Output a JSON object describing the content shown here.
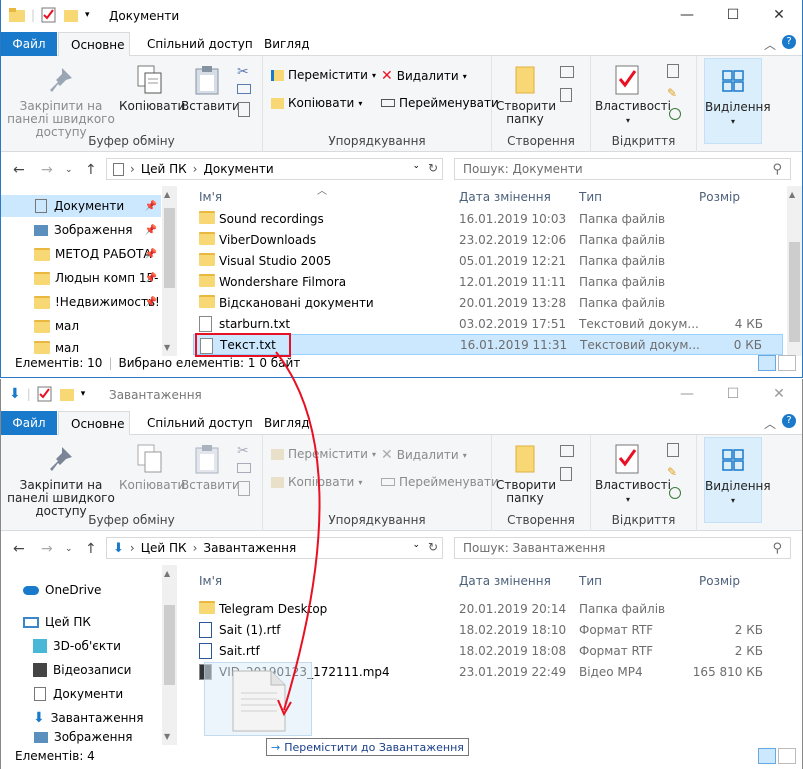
{
  "win1": {
    "title": "Документи",
    "tabs": {
      "file": "Файл",
      "home": "Основне",
      "share": "Спільний доступ",
      "view": "Вигляд"
    },
    "ribbon": {
      "pin_label": "Закріпити на панелі швидкого доступу",
      "copy_label": "Копіювати",
      "paste_label": "Вставити",
      "clipboard_group": "Буфер обміну",
      "move_to": "Перемістити",
      "copy_to": "Копіювати",
      "delete": "Видалити",
      "rename": "Перейменувати",
      "organize_group": "Упорядкування",
      "new_folder": "Створити папку",
      "new_group": "Створення",
      "properties": "Властивості",
      "open_group": "Відкриття",
      "select": "Виділення"
    },
    "breadcrumb": [
      "Цей ПК",
      "Документи"
    ],
    "search_placeholder": "Пошук: Документи",
    "nav_items": [
      {
        "label": "Документи",
        "icon": "documents-icon",
        "pinned": true
      },
      {
        "label": "Зображення",
        "icon": "pictures-icon",
        "pinned": true
      },
      {
        "label": "МЕТОД РАБОТА",
        "icon": "folder-icon",
        "pinned": true
      },
      {
        "label": "Людын комп 15-",
        "icon": "folder-icon",
        "pinned": true
      },
      {
        "label": "!Недвижимость!",
        "icon": "folder-icon",
        "pinned": true
      },
      {
        "label": "мал",
        "icon": "folder-icon",
        "pinned": false
      },
      {
        "label": "мал",
        "icon": "folder-icon",
        "pinned": false
      }
    ],
    "columns": {
      "name": "Ім'я",
      "date": "Дата змінення",
      "type": "Тип",
      "size": "Розмір"
    },
    "files": [
      {
        "name": "Sound recordings",
        "date": "16.01.2019 10:03",
        "type": "Папка файлів",
        "size": "",
        "kind": "folder"
      },
      {
        "name": "ViberDownloads",
        "date": "23.02.2019 12:06",
        "type": "Папка файлів",
        "size": "",
        "kind": "folder"
      },
      {
        "name": "Visual Studio 2005",
        "date": "05.01.2019 12:21",
        "type": "Папка файлів",
        "size": "",
        "kind": "folder"
      },
      {
        "name": "Wondershare Filmora",
        "date": "12.01.2019 11:11",
        "type": "Папка файлів",
        "size": "",
        "kind": "folder"
      },
      {
        "name": "Відскановані документи",
        "date": "20.01.2019 13:28",
        "type": "Папка файлів",
        "size": "",
        "kind": "folder"
      },
      {
        "name": "starburn.txt",
        "date": "03.02.2019 17:51",
        "type": "Текстовий докум...",
        "size": "4 КБ",
        "kind": "txt"
      },
      {
        "name": "Текст.txt",
        "date": "16.01.2019 11:31",
        "type": "Текстовий докум...",
        "size": "0 КБ",
        "kind": "txt",
        "selected": true
      }
    ],
    "status": {
      "count": "Елементів: 10",
      "selected": "Вибрано елементів: 1  0 байт"
    }
  },
  "win2": {
    "title": "Завантаження",
    "breadcrumb": [
      "Цей ПК",
      "Завантаження"
    ],
    "search_placeholder": "Пошук: Завантаження",
    "nav_items": [
      {
        "label": "OneDrive",
        "icon": "onedrive-icon"
      },
      {
        "label": "Цей ПК",
        "icon": "this-pc-icon"
      },
      {
        "label": "3D-об'єкти",
        "icon": "3d-objects-icon"
      },
      {
        "label": "Відеозаписи",
        "icon": "videos-icon"
      },
      {
        "label": "Документи",
        "icon": "documents-icon"
      },
      {
        "label": "Завантаження",
        "icon": "downloads-icon"
      },
      {
        "label": "Зображення",
        "icon": "pictures-icon"
      }
    ],
    "files": [
      {
        "name": "Telegram Desktop",
        "date": "20.01.2019 20:14",
        "type": "Папка файлів",
        "size": "",
        "kind": "folder"
      },
      {
        "name": "Sait (1).rtf",
        "date": "18.02.2019 18:10",
        "type": "Формат RTF",
        "size": "2 КБ",
        "kind": "rtf"
      },
      {
        "name": "Sait.rtf",
        "date": "18.02.2019 18:08",
        "type": "Формат RTF",
        "size": "2 КБ",
        "kind": "rtf"
      },
      {
        "name": "VID_20190123_172111.mp4",
        "date": "23.01.2019 22:49",
        "type": "Відео MP4",
        "size": "165 810 КБ",
        "kind": "mp4"
      }
    ],
    "status": {
      "count": "Елементів: 4"
    },
    "drag_tooltip": "Перемістити до Завантаження"
  },
  "colors": {
    "accent": "#1979ca",
    "selection": "#cce8ff",
    "highlight_box": "#e81123",
    "arrow": "#e81123"
  }
}
